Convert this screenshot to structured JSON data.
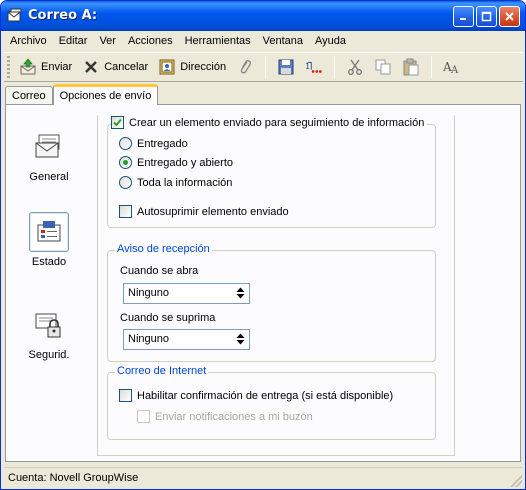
{
  "window": {
    "title": "Correo A:"
  },
  "menu": [
    "Archivo",
    "Editar",
    "Ver",
    "Acciones",
    "Herramientas",
    "Ventana",
    "Ayuda"
  ],
  "toolbar": {
    "send_label": "Enviar",
    "cancel_label": "Cancelar",
    "address_label": "Dirección",
    "icons": [
      "send-icon",
      "cancel-icon",
      "address-book-icon",
      "attach-icon",
      "save-icon",
      "spell-check-icon",
      "cut-icon",
      "copy-icon",
      "paste-icon",
      "font-icon"
    ]
  },
  "tabs": [
    {
      "label": "Correo",
      "active": false
    },
    {
      "label": "Opciones de envío",
      "active": true
    }
  ],
  "categories": [
    {
      "label": "General",
      "icon": "general-envelope-icon",
      "selected": false
    },
    {
      "label": "Estado",
      "icon": "status-icon",
      "selected": true
    },
    {
      "label": "Segurid.",
      "icon": "security-lock-icon",
      "selected": false
    }
  ],
  "tracking": {
    "create_label": "Crear un elemento enviado para seguimiento de información",
    "create_checked": true,
    "options": [
      {
        "label": "Entregado",
        "selected": false
      },
      {
        "label": "Entregado y abierto",
        "selected": true
      },
      {
        "label": "Toda la información",
        "selected": false
      }
    ],
    "autodelete_label": "Autosuprimir elemento enviado",
    "autodelete_checked": false
  },
  "receipt": {
    "legend": "Aviso de recepción",
    "opened_label": "Cuando se abra",
    "opened_value": "Ninguno",
    "deleted_label": "Cuando se suprima",
    "deleted_value": "Ninguno"
  },
  "internet": {
    "legend": "Correo de Internet",
    "delivery_label": "Habilitar confirmación de entrega (si está disponible)",
    "delivery_checked": false,
    "notify_label": "Enviar notificaciones a mi buzón",
    "notify_checked": false
  },
  "status": {
    "account": "Cuenta: Novell GroupWise"
  },
  "colors": {
    "titlebar": "#0054e3",
    "legend": "#0046d5",
    "radio_dot": "#21a121",
    "tab_highlight": "#ffc83c"
  }
}
